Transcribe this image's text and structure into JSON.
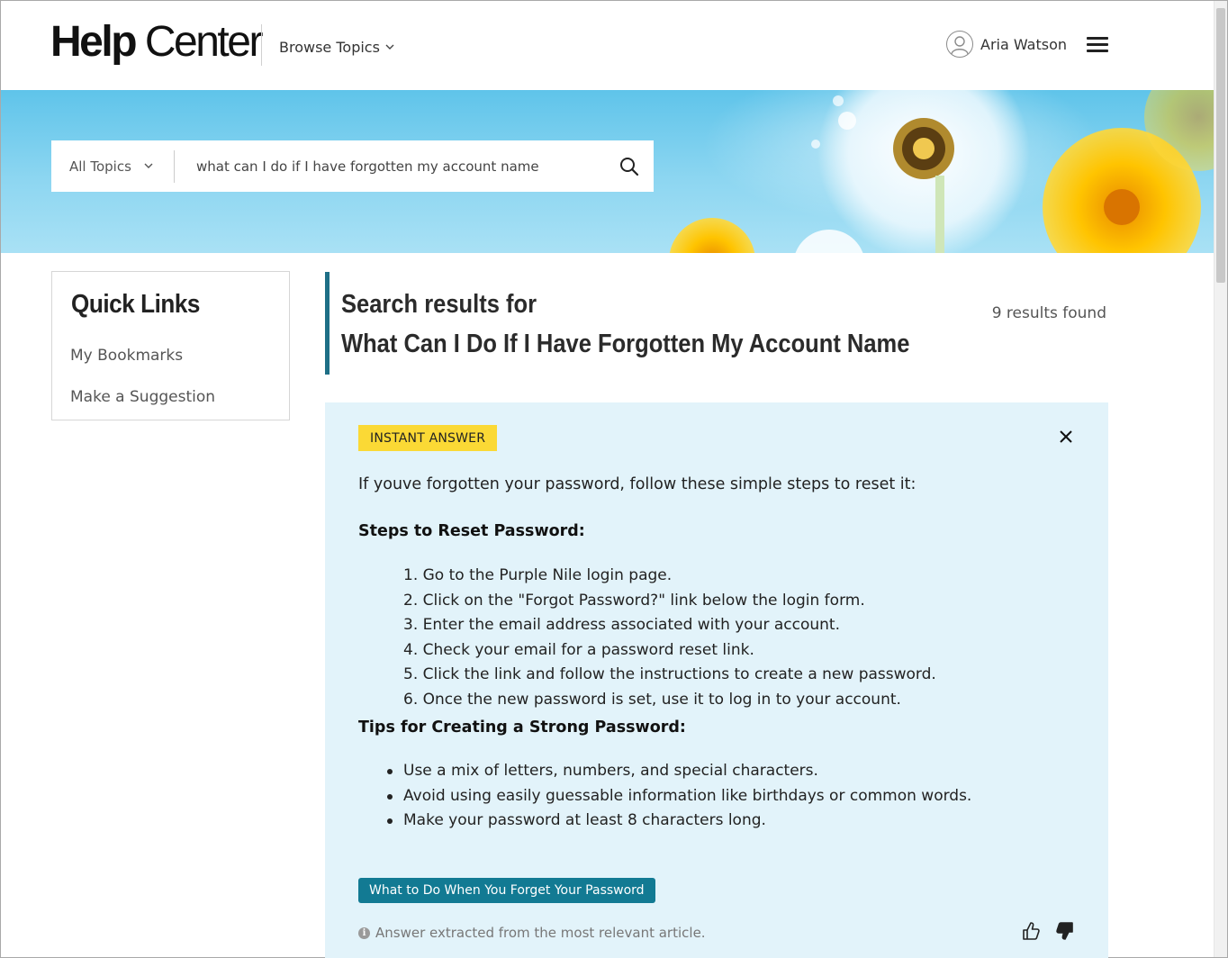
{
  "header": {
    "logo_bold": "Help",
    "logo_light": "Center",
    "browse_label": "Browse Topics",
    "user_name": "Aria Watson"
  },
  "search": {
    "topics_label": "All Topics",
    "query": "what can I do if I have forgotten my account name"
  },
  "sidebar": {
    "title": "Quick Links",
    "links": [
      "My Bookmarks",
      "Make a Suggestion"
    ]
  },
  "results": {
    "title_line1": "Search results for",
    "title_line2": "What Can I Do If I Have Forgotten My Account Name",
    "count": "9 results found"
  },
  "answer": {
    "badge": "INSTANT ANSWER",
    "intro": "If youve forgotten your password, follow these simple steps to reset it:",
    "steps_heading": "Steps to Reset Password:",
    "steps": [
      "1. Go to the Purple Nile login page.",
      "2. Click on the \"Forgot Password?\" link below the login form.",
      "3. Enter the email address associated with your account.",
      "4. Check your email for a password reset link.",
      "5. Click the link and follow the instructions to create a new password.",
      "6. Once the new password is set, use it to log in to your account."
    ],
    "tips_heading": "Tips for Creating a Strong Password:",
    "tips": [
      "Use a mix of letters, numbers, and special characters.",
      "Avoid using easily guessable information like birthdays or common words.",
      "Make your password at least 8 characters long."
    ],
    "article_button": "What to Do When You Forget Your Password",
    "footnote": "Answer extracted from the most relevant article."
  },
  "colors": {
    "accent": "#127a93",
    "badge": "#fbd935",
    "answer_bg": "#e2f3fa",
    "results_bar": "#1e6f86"
  },
  "icons": [
    "chevron-down-icon",
    "user-avatar-icon",
    "hamburger-menu-icon",
    "search-icon",
    "close-icon",
    "info-icon",
    "thumbs-up-icon",
    "thumbs-down-icon"
  ]
}
